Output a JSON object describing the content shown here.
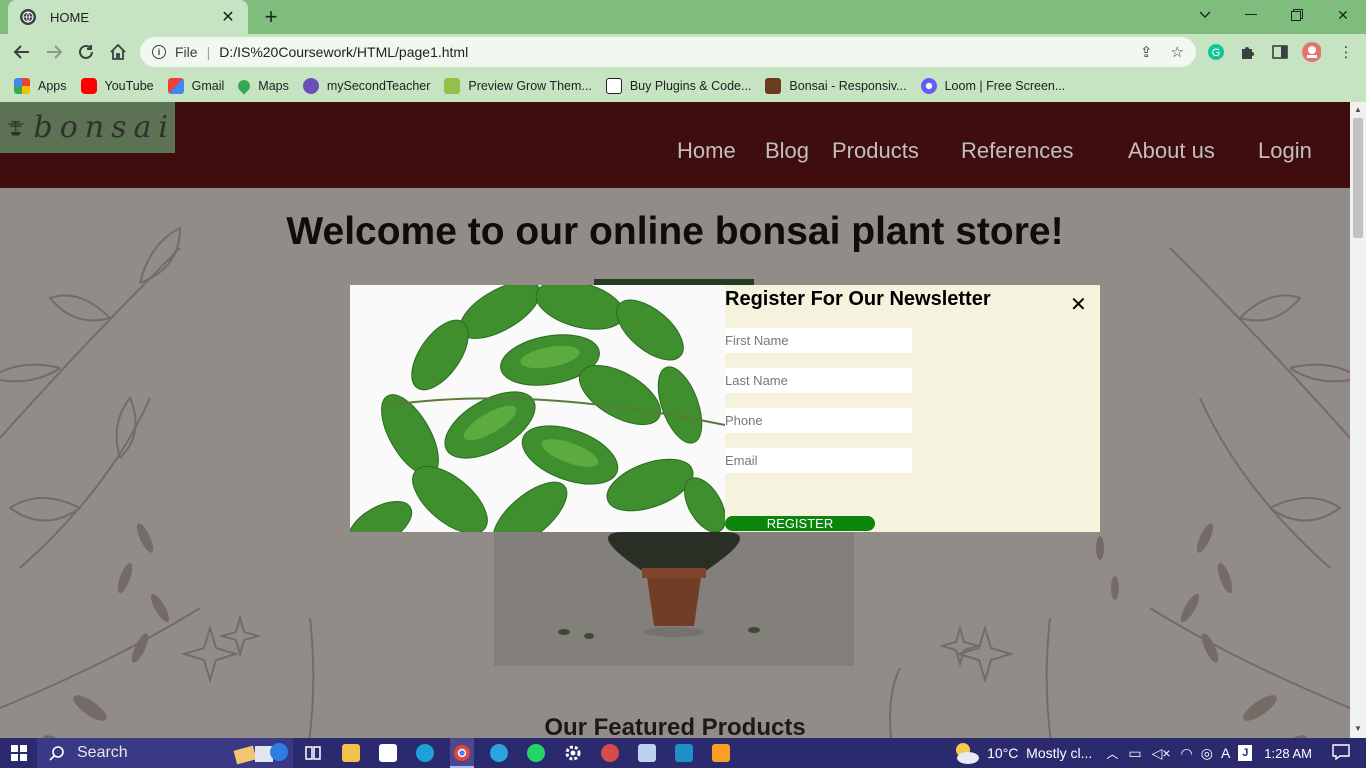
{
  "browser": {
    "tab_title": "HOME",
    "url_scheme": "File",
    "url": "D:/IS%20Coursework/HTML/page1.html",
    "bookmarks": [
      {
        "label": "Apps",
        "color": "#4285f4"
      },
      {
        "label": "YouTube",
        "color": "#ff0000"
      },
      {
        "label": "Gmail",
        "color": "#ea4335"
      },
      {
        "label": "Maps",
        "color": "#34a853"
      },
      {
        "label": "mySecondTeacher",
        "color": "#6b4fbb"
      },
      {
        "label": "Preview Grow Them...",
        "color": "#95bf47"
      },
      {
        "label": "Buy Plugins & Code...",
        "color": "#222222"
      },
      {
        "label": "Bonsai - Responsiv...",
        "color": "#6b3b1f"
      },
      {
        "label": "Loom | Free Screen...",
        "color": "#625df5"
      }
    ]
  },
  "site": {
    "logo_text": "bonsai",
    "nav": [
      "Home",
      "Blog",
      "Products",
      "References",
      "About us",
      "Login"
    ],
    "hero_title": "Welcome to our online bonsai plant store!",
    "featured_heading": "Our Featured Products"
  },
  "modal": {
    "heading": "Register For Our Newsletter",
    "close_glyph": "✕",
    "fields": {
      "first_name": "First Name",
      "last_name": "Last Name",
      "phone": "Phone",
      "email": "Email"
    },
    "register_label": "REGISTER"
  },
  "taskbar": {
    "search_label": "Search",
    "weather": "10°C  Mostly cl...",
    "time": "1:28 AM"
  },
  "colors": {
    "header_bg": "#3d0004",
    "nav_text": "#d9d9d9",
    "modal_bg": "#f5f3dd",
    "register_bg": "#0b850b",
    "chrome_frame": "#7fbd7d"
  }
}
